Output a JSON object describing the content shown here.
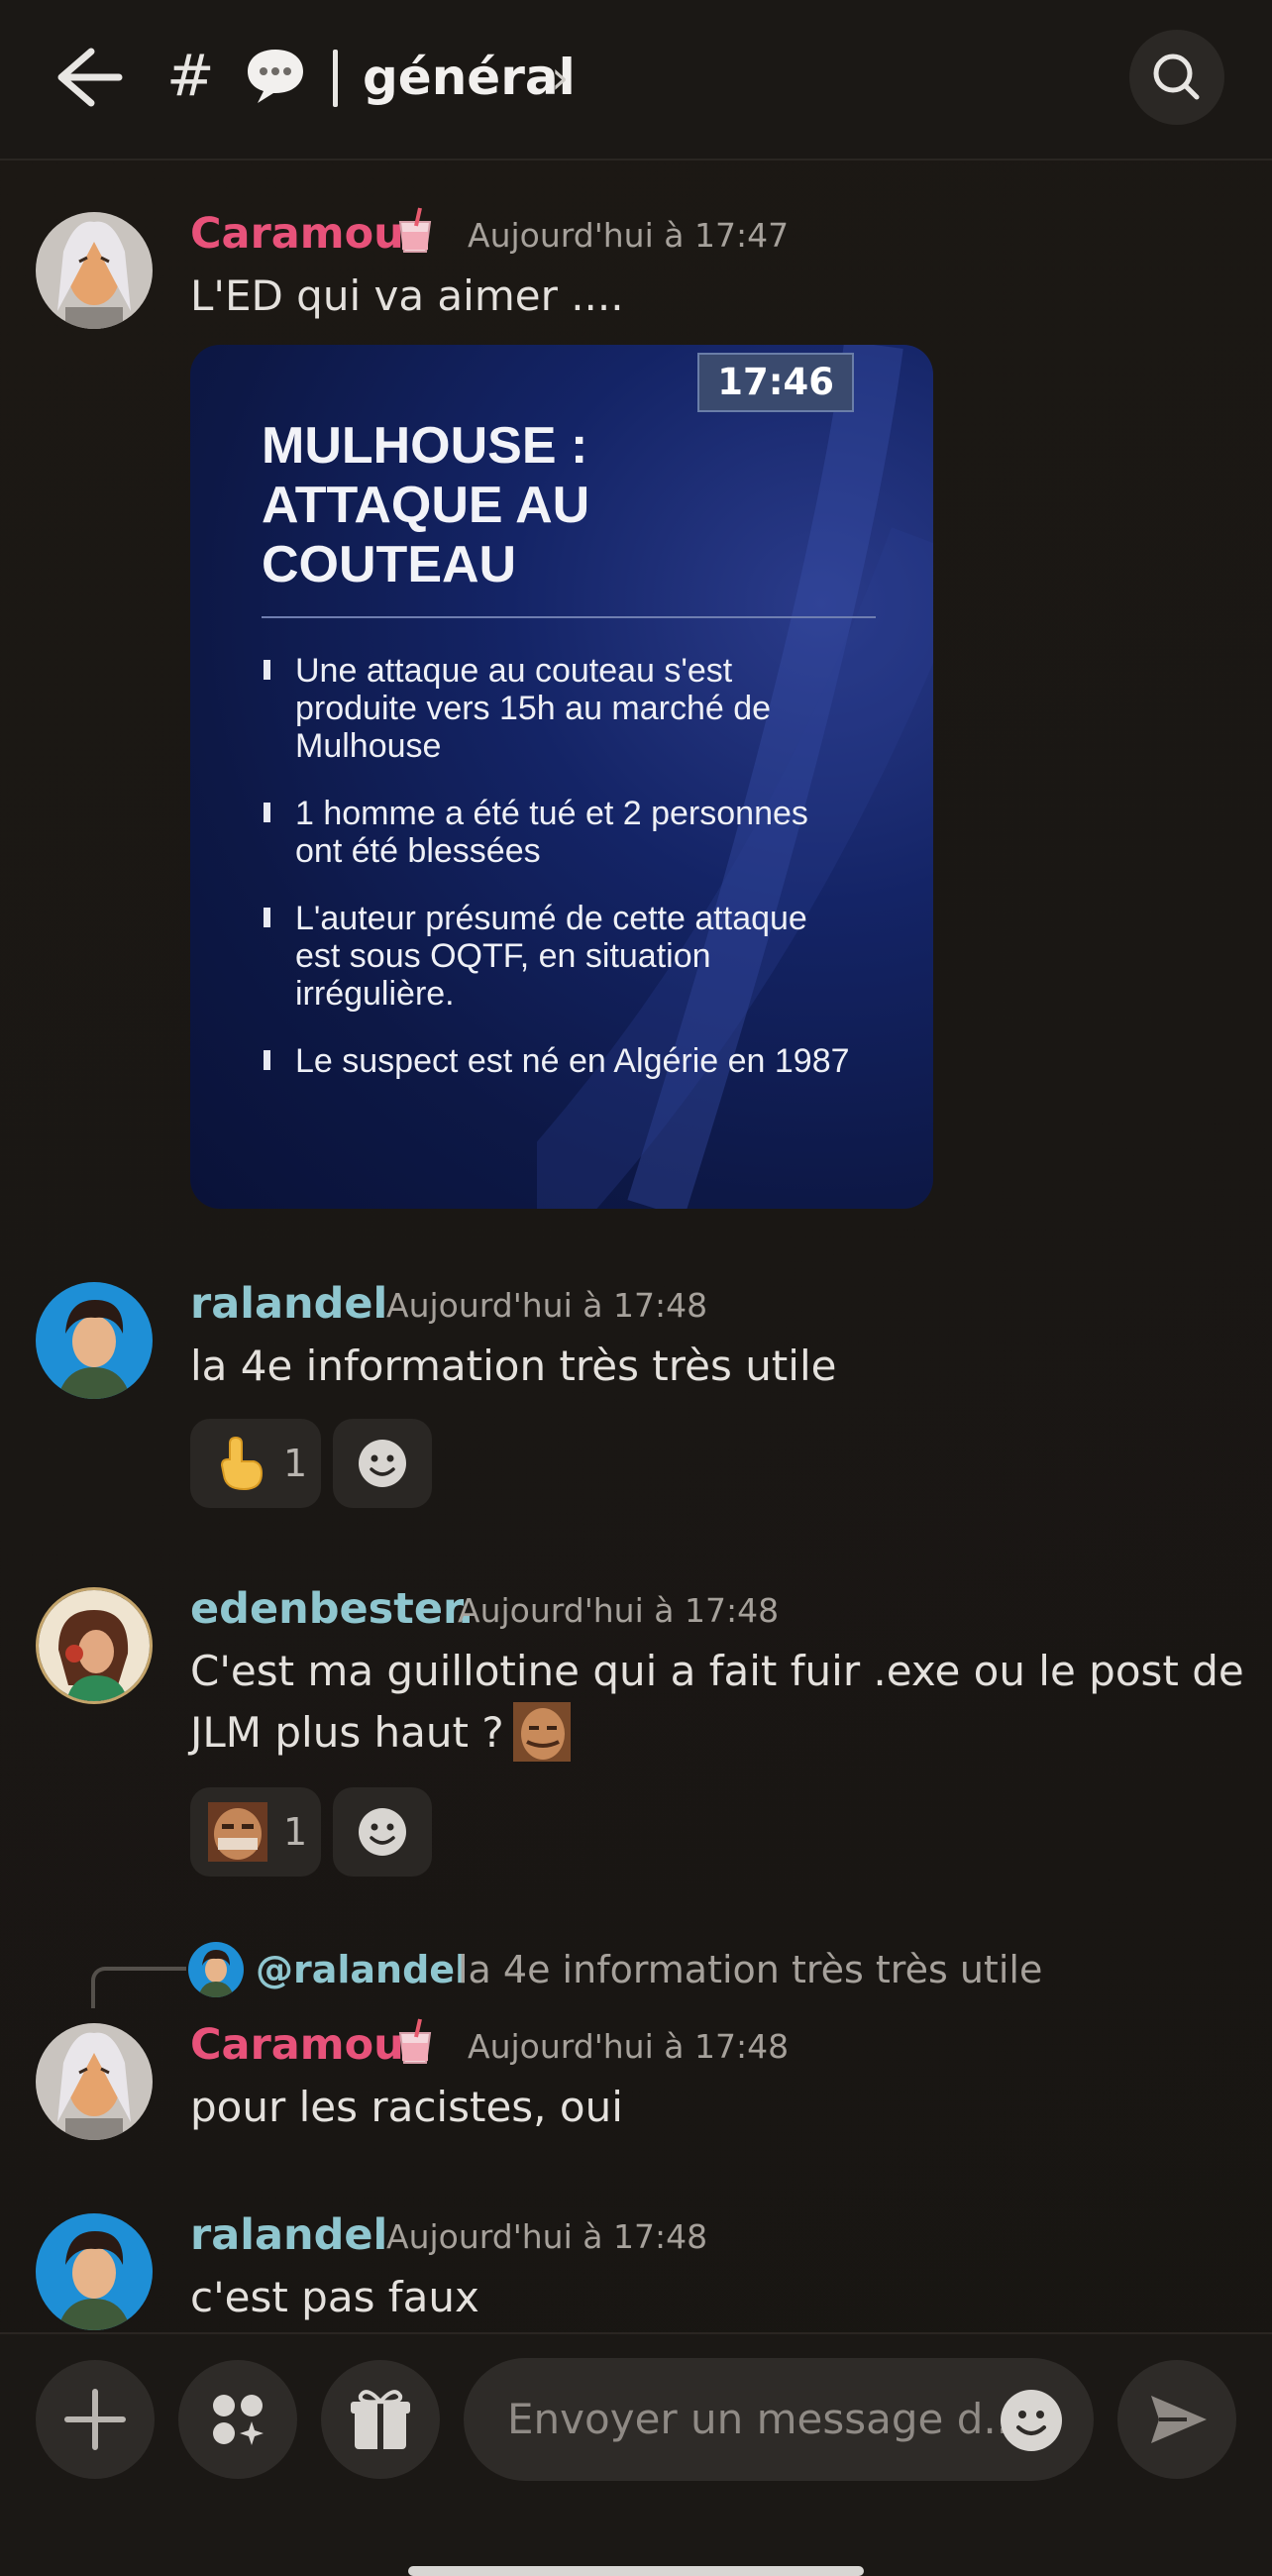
{
  "header": {
    "channel_name": "général",
    "chevron": "›",
    "hash": "#"
  },
  "messages": [
    {
      "author": "Caramou",
      "time": "Aujourd'hui à 17:47",
      "text": "L'ED qui va aimer ...."
    },
    {
      "author": "ralandel",
      "time": "Aujourd'hui à 17:48",
      "text": "la 4e information très très utile",
      "reaction_count": "1"
    },
    {
      "author": "edenbester.",
      "time": "Aujourd'hui à 17:48",
      "text_line1": "C'est ma guillotine qui a fait fuir .exe ou le post de",
      "text_line2": "JLM plus haut ?",
      "reaction_count": "1"
    },
    {
      "reply_to_name": "@ralandel",
      "reply_to_text": "la 4e information très très utile",
      "author": "Caramou",
      "time": "Aujourd'hui à 17:48",
      "text": "pour les racistes, oui"
    },
    {
      "author": "ralandel",
      "time": "Aujourd'hui à 17:48",
      "text": "c'est pas faux"
    }
  ],
  "attachment": {
    "timestamp": "17:46",
    "title": "MULHOUSE :\nATTAQUE AU\nCOUTEAU",
    "bullets": [
      "Une attaque au couteau s'est produite vers 15h au marché de Mulhouse",
      "1 homme a été tué et 2 personnes ont été blessées",
      "L'auteur présumé de cette attaque est sous OQTF, en situation irrégulière.",
      "Le suspect est né en Algérie en 1987"
    ]
  },
  "composer": {
    "placeholder": "Envoyer un message d..."
  },
  "colors": {
    "accent_pink": "#e8527a",
    "accent_teal": "#8fc6cf",
    "background": "#1b1815"
  },
  "icons": [
    "back-arrow-icon",
    "chat-bubble-icon",
    "search-icon",
    "plus-icon",
    "apps-icon",
    "gift-icon",
    "emoji-icon",
    "send-icon"
  ]
}
